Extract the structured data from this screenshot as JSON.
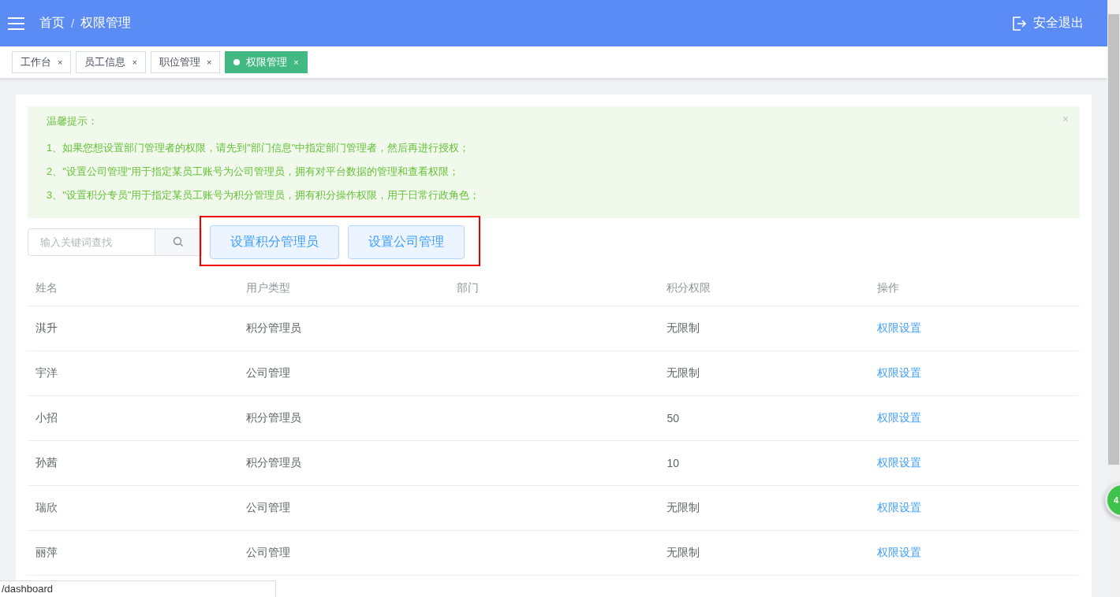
{
  "header": {
    "breadcrumb": [
      "首页",
      "/",
      "权限管理"
    ],
    "logout": "安全退出"
  },
  "tabs": [
    {
      "label": "工作台",
      "close": "×",
      "selected": false
    },
    {
      "label": "员工信息",
      "close": "×",
      "selected": false
    },
    {
      "label": "职位管理",
      "close": "×",
      "selected": false
    },
    {
      "label": "权限管理",
      "close": "×",
      "selected": true
    }
  ],
  "notice": {
    "title": "温馨提示：",
    "close": "×",
    "lines": [
      "1、如果您想设置部门管理者的权限，请先到\"部门信息\"中指定部门管理者，然后再进行授权；",
      "2、\"设置公司管理\"用于指定某员工账号为公司管理员，拥有对平台数据的管理和查看权限；",
      "3、\"设置积分专员\"用于指定某员工账号为积分管理员，拥有积分操作权限，用于日常行政角色；"
    ]
  },
  "search": {
    "placeholder": "输入关键词查找"
  },
  "actions": [
    "设置积分管理员",
    "设置公司管理"
  ],
  "table": {
    "columns": [
      "姓名",
      "用户类型",
      "部门",
      "积分权限",
      "操作"
    ],
    "rows": [
      {
        "name": "淇升",
        "type": "积分管理员",
        "dept": "",
        "points": "无限制",
        "action": "权限设置"
      },
      {
        "name": "宇洋",
        "type": "公司管理",
        "dept": "",
        "points": "无限制",
        "action": "权限设置"
      },
      {
        "name": "小招",
        "type": "积分管理员",
        "dept": "",
        "points": "50",
        "action": "权限设置"
      },
      {
        "name": "孙茜",
        "type": "积分管理员",
        "dept": "",
        "points": "10",
        "action": "权限设置"
      },
      {
        "name": "瑞欣",
        "type": "公司管理",
        "dept": "",
        "points": "无限制",
        "action": "权限设置"
      },
      {
        "name": "丽萍",
        "type": "公司管理",
        "dept": "",
        "points": "无限制",
        "action": "权限设置"
      }
    ]
  },
  "status_bar": "/dashboard",
  "badge": "4"
}
